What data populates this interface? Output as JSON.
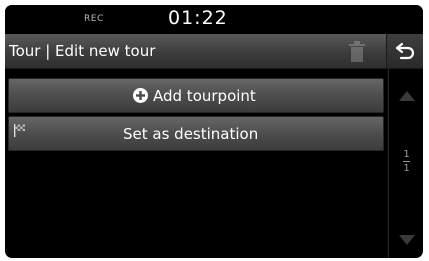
{
  "status_bar": {
    "rec_label": "REC",
    "time": "01:22"
  },
  "header": {
    "title": "Tour | Edit new tour",
    "back_icon": "back-arrow-icon",
    "delete_icon": "trash-icon"
  },
  "list": {
    "items": [
      {
        "label": "Add tourpoint",
        "icon": "plus-circle-icon"
      },
      {
        "label": "Set as destination",
        "icon": "flag-icon"
      }
    ]
  },
  "pagination": {
    "current": "1",
    "total": "1"
  },
  "colors": {
    "screen_bg": "#000000",
    "button_top": "#666666",
    "button_bottom": "#3c3c3c",
    "text": "#ffffff"
  }
}
